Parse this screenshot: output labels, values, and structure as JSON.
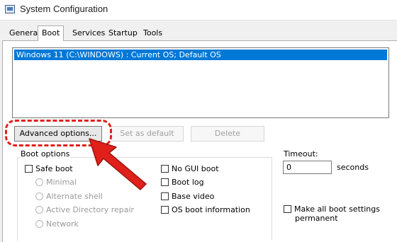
{
  "window": {
    "title": "System Configuration",
    "icon": "msconfig-icon"
  },
  "tabs": [
    {
      "label": "General",
      "active": false
    },
    {
      "label": "Boot",
      "active": true
    },
    {
      "label": "Services",
      "active": false
    },
    {
      "label": "Startup",
      "active": false
    },
    {
      "label": "Tools",
      "active": false
    }
  ],
  "os_list": {
    "items": [
      "Windows 11 (C:\\WINDOWS) : Current OS; Default OS"
    ],
    "selected_index": 0
  },
  "buttons": {
    "advanced": "Advanced options...",
    "set_default": "Set as default",
    "delete": "Delete"
  },
  "boot_options": {
    "label": "Boot options",
    "safe_boot": "Safe boot",
    "minimal": "Minimal",
    "alternate_shell": "Alternate shell",
    "active_directory_repair": "Active Directory repair",
    "network": "Network",
    "no_gui_boot": "No GUI boot",
    "boot_log": "Boot log",
    "base_video": "Base video",
    "os_boot_information": "OS boot information"
  },
  "timeout": {
    "label": "Timeout:",
    "value": "0",
    "unit": "seconds"
  },
  "make_permanent": {
    "line1": "Make all boot settings",
    "line2": "permanent"
  },
  "colors": {
    "selection": "#0078d7",
    "annotation": "#e0201b"
  }
}
